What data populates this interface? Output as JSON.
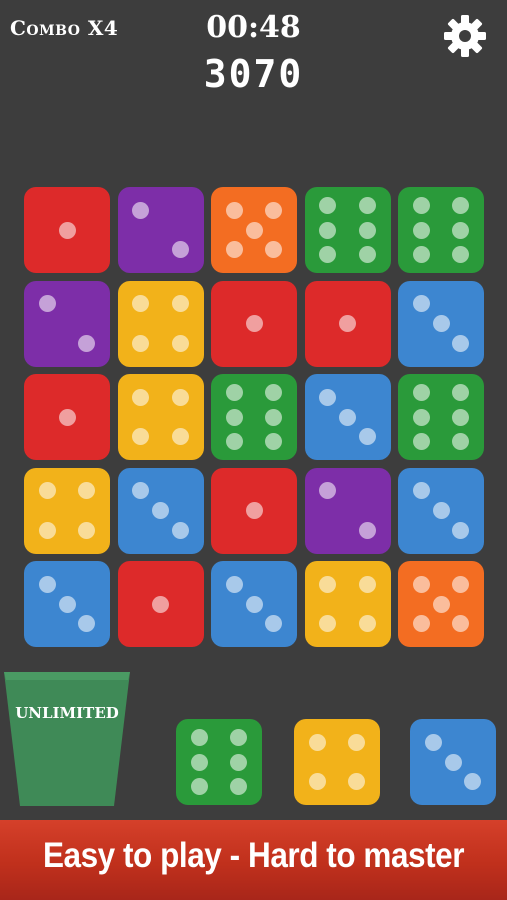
{
  "hud": {
    "combo": "Combo X4",
    "timer": "00:48",
    "score": "3070",
    "settings_icon": "gear-icon"
  },
  "colors": {
    "background": "#3d3d3d",
    "red": "#dd2a2a",
    "purple": "#7d2ea8",
    "orange": "#f36d22",
    "green": "#2a9a3a",
    "yellow": "#f2b21a",
    "blue": "#3d86d0",
    "cup": "#3f8a57",
    "banner": "#c0301c"
  },
  "board": {
    "rows": [
      [
        {
          "color": "red",
          "value": 1
        },
        {
          "color": "purple",
          "value": 2
        },
        {
          "color": "orange",
          "value": 5
        },
        {
          "color": "green",
          "value": 6
        },
        {
          "color": "green",
          "value": 6
        }
      ],
      [
        {
          "color": "purple",
          "value": 2
        },
        {
          "color": "yellow",
          "value": 4
        },
        {
          "color": "red",
          "value": 1
        },
        {
          "color": "red",
          "value": 1
        },
        {
          "color": "blue",
          "value": 3
        }
      ],
      [
        {
          "color": "red",
          "value": 1
        },
        {
          "color": "yellow",
          "value": 4
        },
        {
          "color": "green",
          "value": 6
        },
        {
          "color": "blue",
          "value": 3
        },
        {
          "color": "green",
          "value": 6
        }
      ],
      [
        {
          "color": "yellow",
          "value": 4
        },
        {
          "color": "blue",
          "value": 3
        },
        {
          "color": "red",
          "value": 1
        },
        {
          "color": "purple",
          "value": 2
        },
        {
          "color": "blue",
          "value": 3
        }
      ],
      [
        {
          "color": "blue",
          "value": 3
        },
        {
          "color": "red",
          "value": 1
        },
        {
          "color": "blue",
          "value": 3
        },
        {
          "color": "yellow",
          "value": 4
        },
        {
          "color": "orange",
          "value": 5
        }
      ]
    ]
  },
  "next_dice": [
    {
      "color": "green",
      "value": 6
    },
    {
      "color": "yellow",
      "value": 4
    },
    {
      "color": "blue",
      "value": 3
    }
  ],
  "cup": {
    "label": "UNLIMITED"
  },
  "banner": {
    "text": "Easy to play - Hard to master"
  }
}
